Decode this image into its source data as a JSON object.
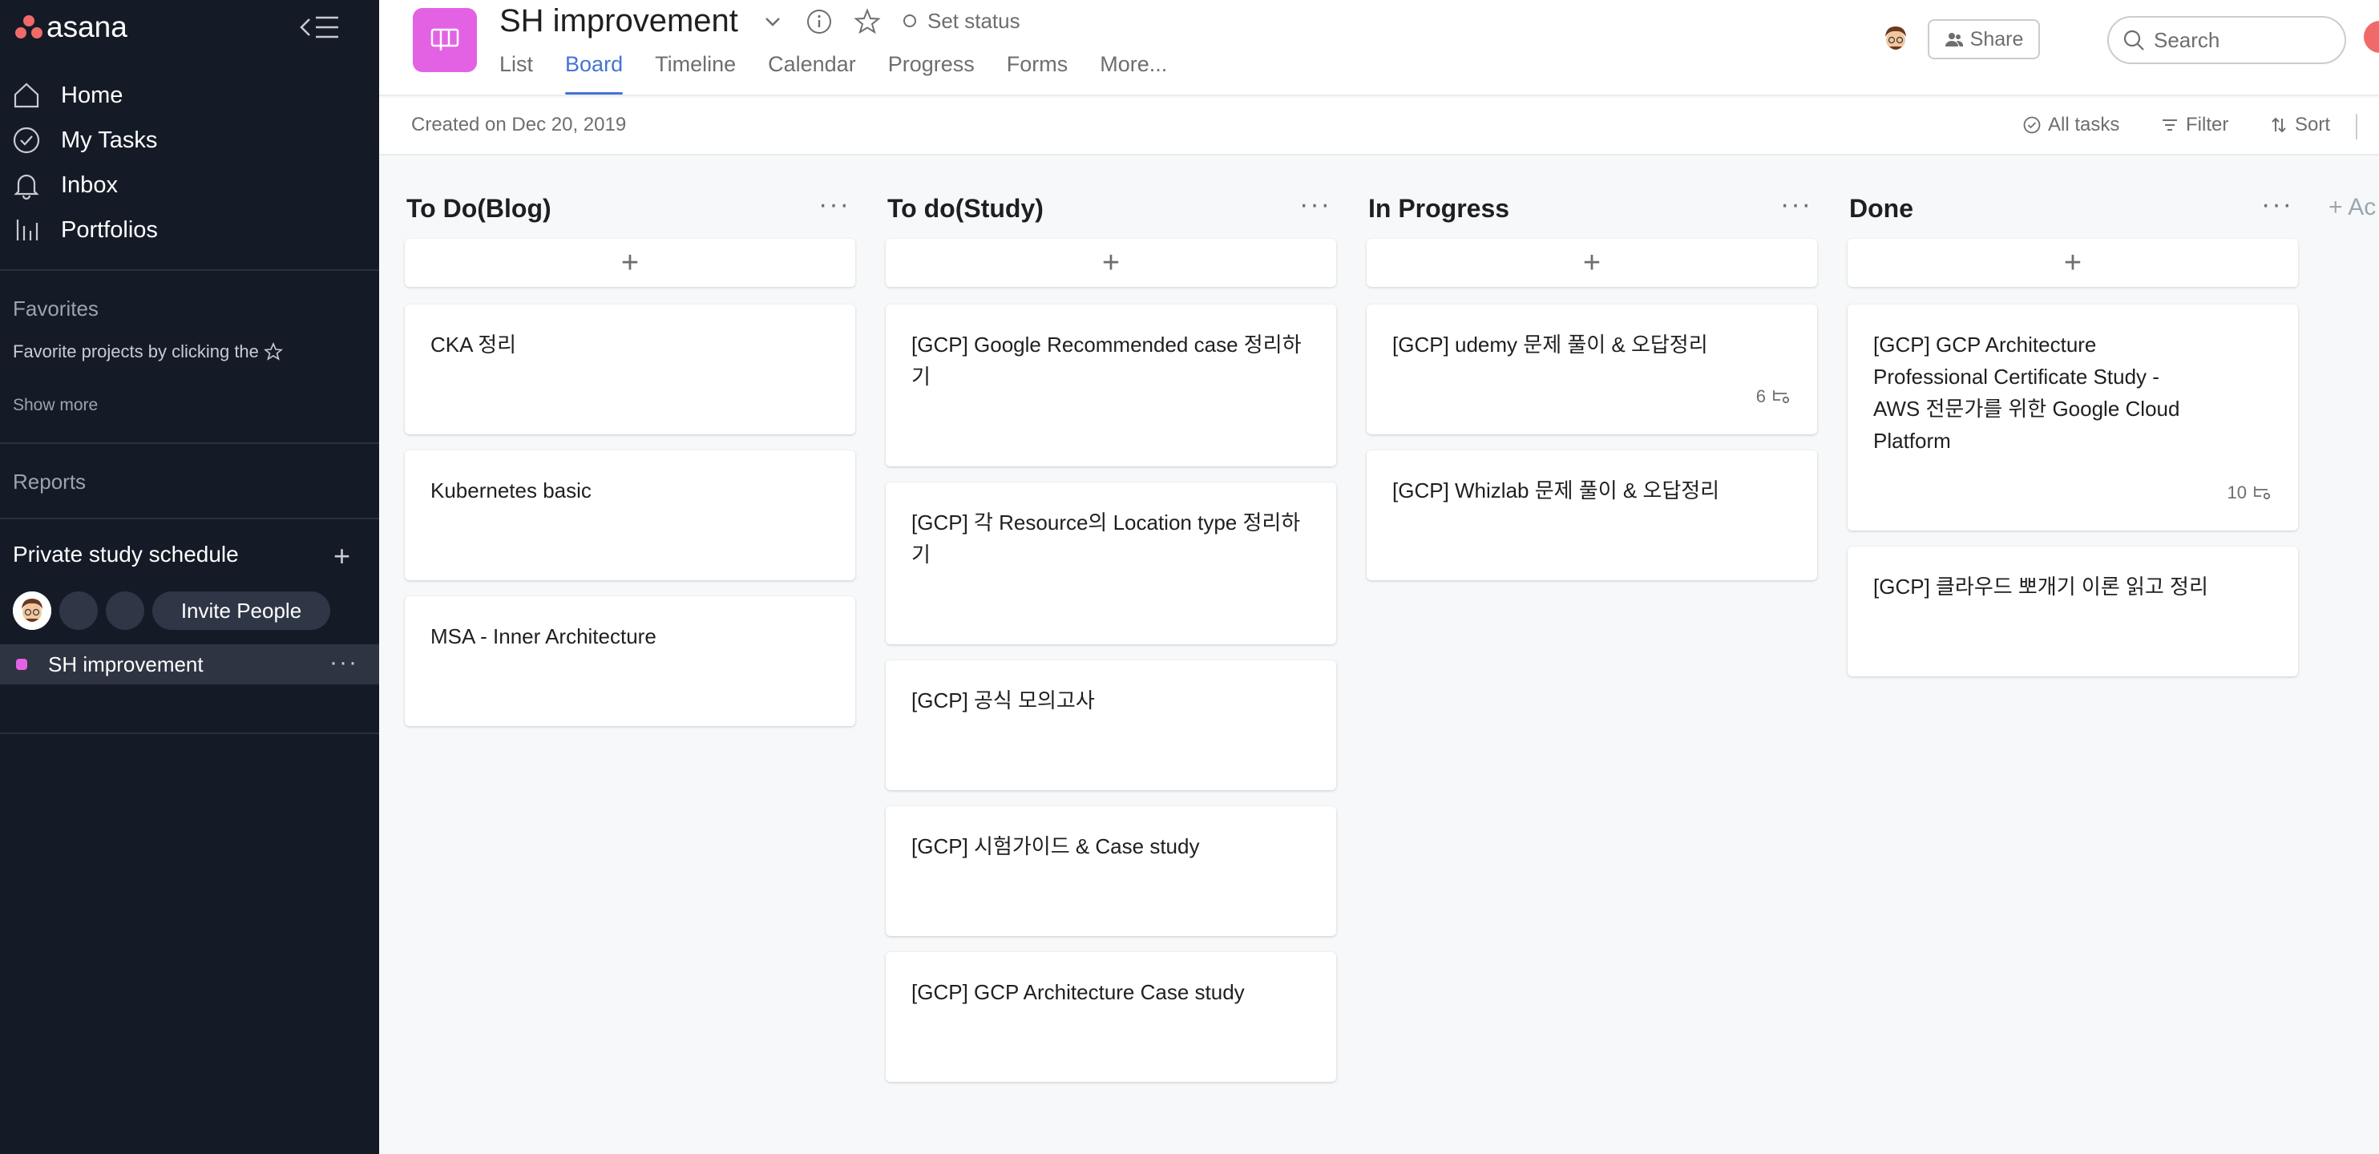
{
  "app": {
    "logo_text": "asana",
    "brand_color": "#f06a6a"
  },
  "sidebar": {
    "nav": [
      {
        "label": "Home",
        "icon": "home-icon"
      },
      {
        "label": "My Tasks",
        "icon": "check-circle-icon"
      },
      {
        "label": "Inbox",
        "icon": "bell-icon"
      },
      {
        "label": "Portfolios",
        "icon": "bar-chart-icon"
      }
    ],
    "favorites_heading": "Favorites",
    "favorites_hint": "Favorite projects by clicking the",
    "show_more": "Show more",
    "reports_heading": "Reports",
    "team_name": "Private study schedule",
    "invite_label": "Invite People",
    "project_name": "SH improvement",
    "project_color": "#e362e3"
  },
  "header": {
    "title": "SH improvement",
    "set_status": "Set status",
    "tabs": [
      "List",
      "Board",
      "Timeline",
      "Calendar",
      "Progress",
      "Forms",
      "More..."
    ],
    "active_tab": "Board",
    "share_label": "Share",
    "search_placeholder": "Search"
  },
  "subbar": {
    "created": "Created on Dec 20, 2019",
    "all_tasks": "All tasks",
    "filter": "Filter",
    "sort": "Sort"
  },
  "board": {
    "add_section": "+ Ac",
    "columns": [
      {
        "title": "To Do(Blog)",
        "cards": [
          {
            "title": "CKA 정리"
          },
          {
            "title": "Kubernetes basic"
          },
          {
            "title": "MSA - Inner Architecture"
          }
        ]
      },
      {
        "title": "To do(Study)",
        "cards": [
          {
            "title": "[GCP] Google Recommended case 정리하기"
          },
          {
            "title": "[GCP] 각 Resource의 Location type 정리하기"
          },
          {
            "title": "[GCP] 공식 모의고사"
          },
          {
            "title": "[GCP] 시험가이드 & Case study"
          },
          {
            "title": "[GCP] GCP Architecture Case study"
          }
        ]
      },
      {
        "title": "In Progress",
        "cards": [
          {
            "title": "[GCP] udemy 문제 풀이 & 오답정리",
            "subtasks": "6"
          },
          {
            "title": "[GCP] Whizlab 문제 풀이 & 오답정리"
          }
        ]
      },
      {
        "title": "Done",
        "cards": [
          {
            "title": "[GCP] GCP Architecture Professional Certificate Study - AWS 전문가를 위한 Google Cloud Platform",
            "subtasks": "10"
          },
          {
            "title": "[GCP] 클라우드 뽀개기 이론 읽고 정리"
          }
        ]
      }
    ]
  }
}
